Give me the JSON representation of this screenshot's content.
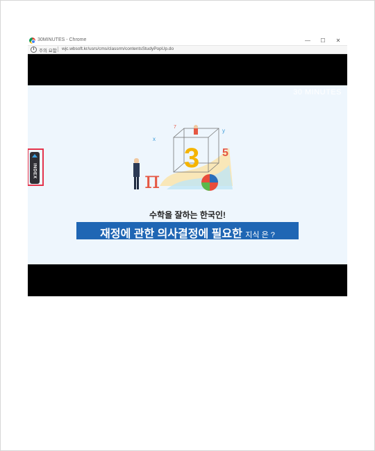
{
  "window": {
    "title": "30MINUTES - Chrome",
    "controls": {
      "minimize": "—",
      "maximize": "☐",
      "close": "✕"
    }
  },
  "address_bar": {
    "security_warning": "주의 요함",
    "url": "wjc.wbsoft.kr/usrs/cms/classrm/contentsStudyPopUp.do"
  },
  "video": {
    "watermark": "30 MINUTES",
    "index_tab": {
      "label": "INDEX"
    },
    "subtitle": "수학을 잘하는 한국인!",
    "headline_main": "재정에 관한 의사결정에 필요한",
    "headline_tail": "지식 은 ?",
    "colors": {
      "headline_bg": "#1f66b4",
      "index_highlight": "#e4334b",
      "background": "#eef6fd"
    }
  }
}
